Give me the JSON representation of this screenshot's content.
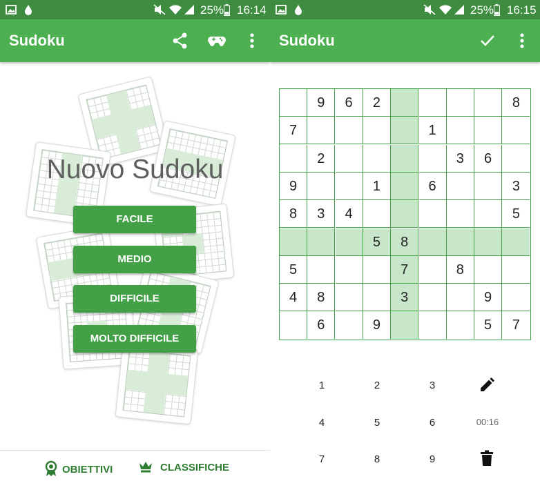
{
  "left": {
    "status": {
      "battery": "25%",
      "time": "16:14"
    },
    "appbar": {
      "title": "Sudoku"
    },
    "hero_title": "Nuovo Sudoku",
    "buttons": [
      "FACILE",
      "MEDIO",
      "DIFFICILE",
      "MOLTO DIFFICILE"
    ],
    "bottom": {
      "achievements": "OBIETTIVI",
      "leaderboards": "CLASSIFICHE"
    }
  },
  "right": {
    "status": {
      "battery": "25%",
      "time": "16:15"
    },
    "appbar": {
      "title": "Sudoku"
    },
    "grid": [
      [
        "",
        "9",
        "6",
        "2",
        "",
        "",
        "",
        "",
        "8"
      ],
      [
        "7",
        "",
        "",
        "",
        "",
        "1",
        "",
        "",
        ""
      ],
      [
        "",
        "2",
        "",
        "",
        "",
        "",
        "3",
        "6",
        ""
      ],
      [
        "9",
        "",
        "",
        "1",
        "",
        "6",
        "",
        "",
        "3"
      ],
      [
        "8",
        "3",
        "4",
        "",
        "",
        "",
        "",
        "",
        "5"
      ],
      [
        "",
        "",
        "",
        "5",
        "8",
        "",
        "",
        "",
        ""
      ],
      [
        "5",
        "",
        "",
        "",
        "7",
        "",
        "8",
        "",
        ""
      ],
      [
        "4",
        "8",
        "",
        "",
        "3",
        "",
        "",
        "9",
        ""
      ],
      [
        "",
        "6",
        "",
        "9",
        "",
        "",
        "",
        "5",
        "7"
      ]
    ],
    "highlight_row": 5,
    "highlight_col": 4,
    "keypad": [
      "1",
      "2",
      "3",
      "4",
      "5",
      "6",
      "7",
      "8",
      "9"
    ],
    "timer": "00:16"
  },
  "colors": {
    "appbar": "#4caf50",
    "status": "#3d8c3f",
    "highlight": "#c8e6c9",
    "grid_line": "#43a047"
  }
}
